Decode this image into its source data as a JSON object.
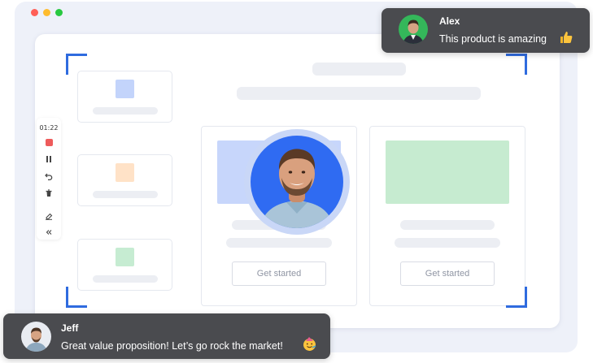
{
  "window": {
    "controls": [
      {
        "name": "close",
        "color": "#ff5f57"
      },
      {
        "name": "minimize",
        "color": "#febc2e"
      },
      {
        "name": "maximize",
        "color": "#28c840"
      }
    ]
  },
  "colors": {
    "accent": "#2f6bdf",
    "bubble_bg": "#4a4b4f",
    "thumb_blue": "#c3d4fb",
    "thumb_orange": "#ffe2c7",
    "thumb_green": "#c6ecd2",
    "image_blue": "#c7d6fb",
    "image_green": "#c6ebd0",
    "record_red": "#ee5b5b"
  },
  "recorder": {
    "timer": "01:22",
    "tools": [
      "stop-icon",
      "pause-icon",
      "undo-icon",
      "trash-icon",
      "eraser-icon",
      "collapse-icon"
    ]
  },
  "cards": [
    {
      "button_label": "Get started"
    },
    {
      "button_label": "Get started"
    }
  ],
  "comments": [
    {
      "author": "Alex",
      "text": "This product is amazing",
      "emoji": "thumbs-up-icon"
    },
    {
      "author": "Jeff",
      "text": "Great value proposition! Let’s go rock the market!",
      "emoji": "party-face-icon"
    }
  ]
}
